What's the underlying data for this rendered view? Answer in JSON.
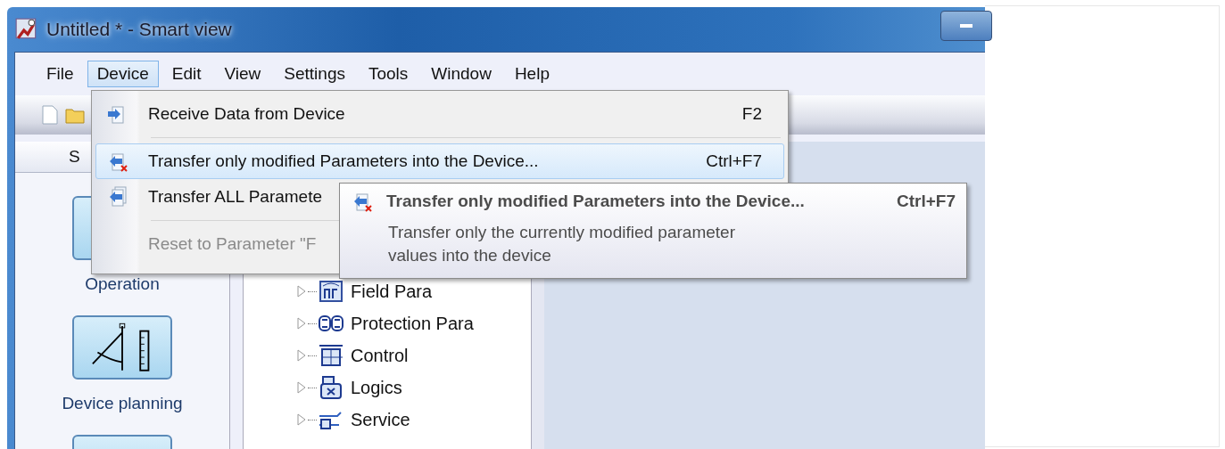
{
  "window": {
    "title": "Untitled * - Smart view"
  },
  "menu_bar": [
    {
      "label": "File",
      "selected": false
    },
    {
      "label": "Device",
      "selected": true
    },
    {
      "label": "Edit",
      "selected": false
    },
    {
      "label": "View",
      "selected": false
    },
    {
      "label": "Settings",
      "selected": false
    },
    {
      "label": "Tools",
      "selected": false
    },
    {
      "label": "Window",
      "selected": false
    },
    {
      "label": "Help",
      "selected": false
    }
  ],
  "device_menu": {
    "items": [
      {
        "kind": "item",
        "label": "Receive Data from Device",
        "shortcut": "F2",
        "highlighted": false,
        "disabled": false
      },
      {
        "kind": "separator"
      },
      {
        "kind": "item",
        "label": "Transfer only modified Parameters into the Device...",
        "shortcut": "Ctrl+F7",
        "highlighted": true,
        "disabled": false
      },
      {
        "kind": "item",
        "label": "Transfer ALL Paramete",
        "highlighted": false,
        "disabled": false
      },
      {
        "kind": "separator"
      },
      {
        "kind": "item",
        "label": "Reset to Parameter \"F",
        "highlighted": false,
        "disabled": true
      }
    ]
  },
  "tooltip": {
    "title": "Transfer only modified Parameters into the Device...",
    "shortcut": "Ctrl+F7",
    "description": "Transfer only the currently modified parameter values into the device"
  },
  "sidebar": {
    "tab_label": "S",
    "buttons": [
      {
        "kind": "operation",
        "label": "Operation"
      },
      {
        "kind": "planning",
        "label": "Device planning"
      },
      {
        "kind": "other"
      }
    ]
  },
  "tree": {
    "items": [
      {
        "label": "Field Para"
      },
      {
        "label": "Protection Para"
      },
      {
        "label": "Control"
      },
      {
        "label": "Logics"
      },
      {
        "label": "Service"
      }
    ]
  }
}
